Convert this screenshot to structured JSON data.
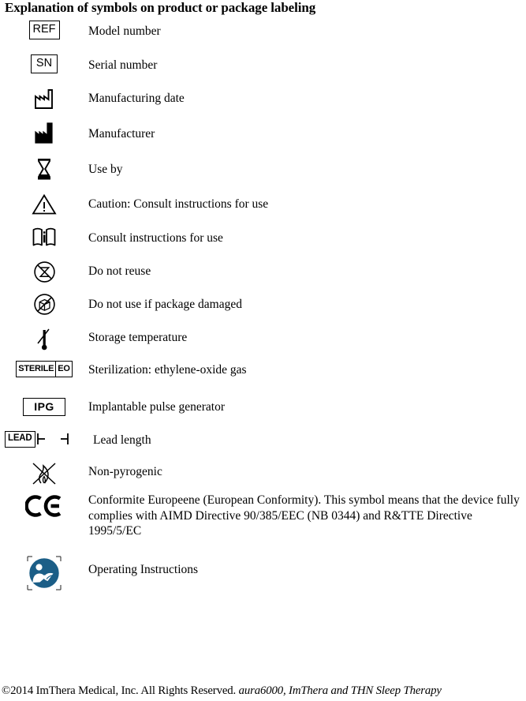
{
  "document": {
    "title": "Explanation of symbols on product or package labeling"
  },
  "symbols": [
    {
      "icon": "ref-box-icon",
      "code": "REF",
      "label": "Model number"
    },
    {
      "icon": "sn-box-icon",
      "code": "SN",
      "label": "Serial number"
    },
    {
      "icon": "factory-outline-icon",
      "code": "",
      "label": "Manufacturing date"
    },
    {
      "icon": "factory-solid-icon",
      "code": "",
      "label": "Manufacturer"
    },
    {
      "icon": "hourglass-icon",
      "code": "",
      "label": "Use by"
    },
    {
      "icon": "warning-triangle-icon",
      "code": "",
      "label": "Caution: Consult instructions for use"
    },
    {
      "icon": "open-book-info-icon",
      "code": "",
      "label": "Consult instructions for use"
    },
    {
      "icon": "do-not-reuse-icon",
      "code": "",
      "label": "Do not reuse"
    },
    {
      "icon": "damaged-package-icon",
      "code": "",
      "label": "Do not use if package damaged"
    },
    {
      "icon": "thermometer-icon",
      "code": "",
      "label": "Storage temperature"
    },
    {
      "icon": "sterile-eo-icon",
      "code": "STERILE",
      "code2": "EO",
      "label": "Sterilization: ethylene-oxide gas"
    },
    {
      "icon": "ipg-box-icon",
      "code": "IPG",
      "label": "Implantable pulse generator"
    },
    {
      "icon": "lead-length-icon",
      "code": "LEAD",
      "label": "Lead length"
    },
    {
      "icon": "non-pyrogenic-icon",
      "code": "",
      "label": "Non-pyrogenic"
    },
    {
      "icon": "ce-mark-icon",
      "code": "",
      "label": "Conformite Europeene (European Conformity).  This symbol means that the device fully complies with AIMD Directive 90/385/EEC (NB 0344) and R&TTE Directive 1995/5/EC"
    },
    {
      "icon": "operating-instructions-icon",
      "code": "",
      "label": "Operating Instructions"
    }
  ],
  "footer": {
    "copyright": "©2014 ImThera Medical, Inc.  All Rights Reserved.  ",
    "trademarks": "aura6000, ImThera and THN Sleep Therapy"
  },
  "colors": {
    "ink": "#000000",
    "page": "#ffffff",
    "instruction_blue": "#1b5e87"
  }
}
